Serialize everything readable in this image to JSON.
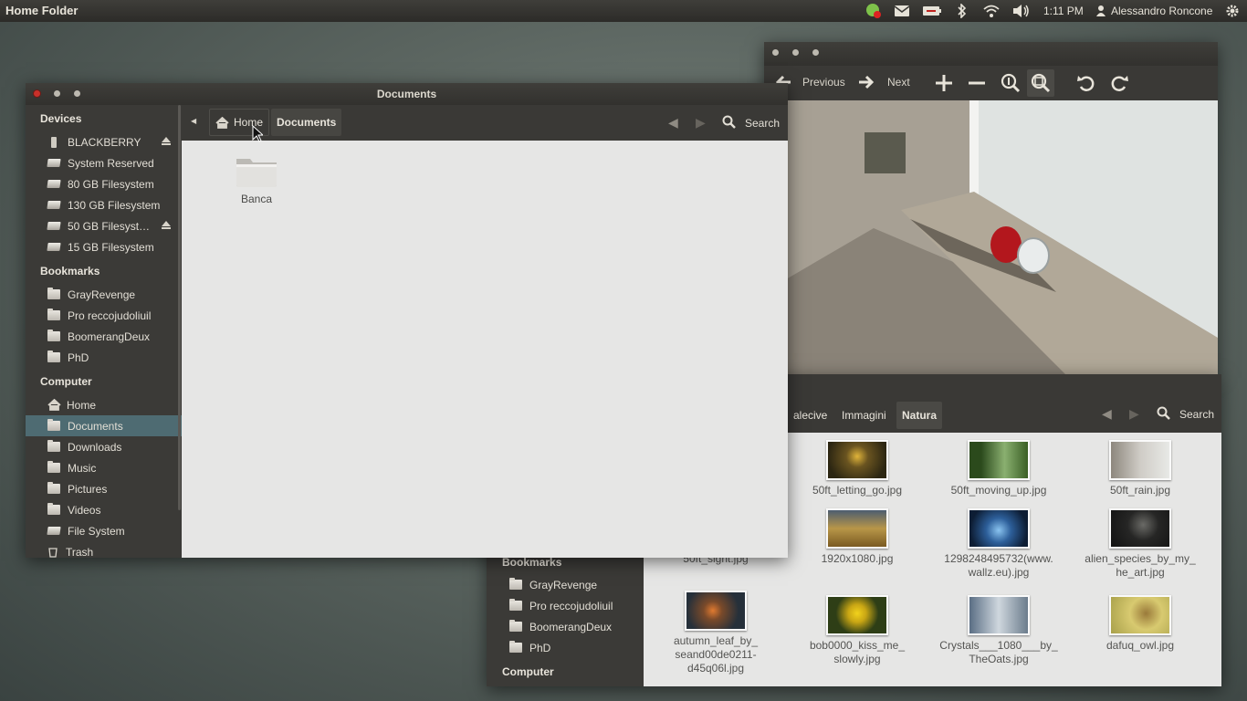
{
  "top_panel": {
    "title": "Home Folder",
    "clock": "1:11 PM",
    "user": "Alessandro Roncone"
  },
  "image_viewer": {
    "toolbar": {
      "previous": "Previous",
      "next": "Next"
    }
  },
  "nautilus_back": {
    "breadcrumbs": [
      "alecive",
      "Immagini",
      "Natura"
    ],
    "search_label": "Search",
    "sidebar": {
      "bookmarks_header": "Bookmarks",
      "bookmarks": [
        "GrayRevenge",
        "Pro reccojudoliuil",
        "BoomerangDeux",
        "PhD"
      ],
      "computer_header": "Computer"
    },
    "files": [
      {
        "name": "50ft_letting_go.jpg",
        "colors": [
          "#3b3016",
          "#8a6a22"
        ]
      },
      {
        "name": "50ft_moving_up.jpg",
        "colors": [
          "#294a1c",
          "#7ba060"
        ]
      },
      {
        "name": "50ft_rain.jpg",
        "colors": [
          "#9a958d",
          "#d8d6d2"
        ]
      },
      {
        "name": "50ft_sight.jpg",
        "colors": [
          "#8b7f73",
          "#cfc6bb"
        ]
      },
      {
        "name": "1920x1080.jpg",
        "colors": [
          "#3b4a5c",
          "#c8a04e"
        ]
      },
      {
        "name": "1298248495732(www.\nwallz.eu).jpg",
        "colors": [
          "#10305a",
          "#5f9bd1"
        ]
      },
      {
        "name": "alien_species_by_my_\nhe_art.jpg",
        "colors": [
          "#161616",
          "#4a4a48"
        ]
      },
      {
        "name": "autumn_leaf_by_\nseand00de0211-\nd45q06l.jpg",
        "colors": [
          "#2a3440",
          "#c6702e"
        ]
      },
      {
        "name": "bob0000_kiss_me_\nslowly.jpg",
        "colors": [
          "#2a3a12",
          "#e6c51c"
        ]
      },
      {
        "name": "Crystals___1080___by_\nTheOats.jpg",
        "colors": [
          "#56687e",
          "#c9d2da"
        ]
      },
      {
        "name": "dafuq_owl.jpg",
        "colors": [
          "#7a6a2a",
          "#d8c86a"
        ]
      }
    ]
  },
  "nautilus_front": {
    "title": "Documents",
    "breadcrumbs": [
      "Home",
      "Documents"
    ],
    "search_label": "Search",
    "sidebar": {
      "devices_header": "Devices",
      "devices": [
        "BLACKBERRY",
        "System Reserved",
        "80 GB Filesystem",
        "130 GB Filesystem",
        "50 GB Filesyst…",
        "15 GB Filesystem"
      ],
      "bookmarks_header": "Bookmarks",
      "bookmarks": [
        "GrayRevenge",
        "Pro reccojudoliuil",
        "BoomerangDeux",
        "PhD"
      ],
      "computer_header": "Computer",
      "computer": [
        "Home",
        "Documents",
        "Downloads",
        "Music",
        "Pictures",
        "Videos",
        "File System",
        "Trash"
      ]
    },
    "files": [
      {
        "name": "Banca"
      }
    ]
  },
  "colors": {
    "panel": "#3a3936",
    "selection": "#4e6b72",
    "content": "#e6e6e5"
  }
}
